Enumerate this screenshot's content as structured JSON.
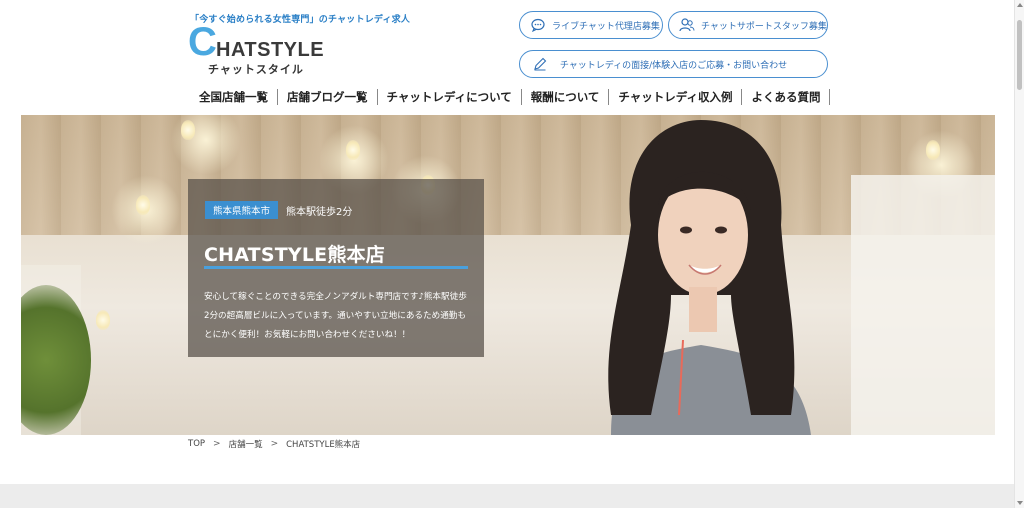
{
  "header": {
    "tagline": "「今すぐ始められる女性専門」のチャットレディ求人",
    "logo_initial": "C",
    "logo_rest": "HATSTYLE",
    "logo_sub": "チャットスタイル",
    "buttons": {
      "agency": "ライブチャット代理店募集",
      "support_staff": "チャットサポートスタッフ募集",
      "contact": "チャットレディの面接/体験入店のご応募・お問い合わせ"
    }
  },
  "nav": [
    {
      "label": "全国店舗一覧"
    },
    {
      "label": "店舗ブログ一覧"
    },
    {
      "label": "チャットレディについて"
    },
    {
      "label": "報酬について"
    },
    {
      "label": "チャットレディ収入例"
    },
    {
      "label": "よくある質問"
    }
  ],
  "hero": {
    "city": "熊本県熊本市",
    "access": "熊本駅徒歩2分",
    "shop_name": "CHATSTYLE熊本店",
    "description": "安心して稼ぐことのできる完全ノンアダルト専門店です♪熊本駅徒歩2分の超高層ビルに入っています。通いやすい立地にあるため通勤もとにかく便利！お気軽にお問い合わせくださいね！！"
  },
  "breadcrumb": {
    "items": [
      "TOP",
      "店舗一覧",
      "CHATSTYLE熊本店"
    ],
    "separator": ">"
  },
  "colors": {
    "accent_blue": "#3b8fd0",
    "logo_blue": "#4aa8e0",
    "button_border": "#4a8fd0"
  }
}
